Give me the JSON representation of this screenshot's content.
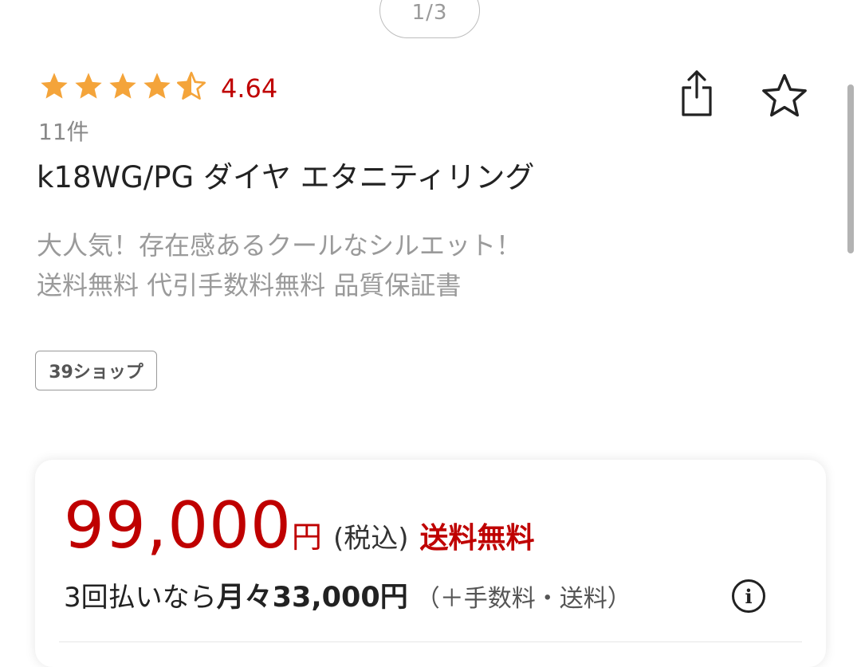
{
  "gallery": {
    "page_indicator": "1/3"
  },
  "rating": {
    "value": "4.64",
    "stars_filled": 4.5,
    "stars_total": 5,
    "review_count": "11件",
    "star_color": "#f4a43a",
    "value_color": "#bf0000"
  },
  "actions": {
    "share_icon": "share-icon",
    "favorite_icon": "star-outline-icon"
  },
  "product": {
    "title": "k18WG/PG ダイヤ エタニティリング",
    "catch_copy_line1": "大人気！存在感あるクールなシルエット！",
    "catch_copy_line2": "送料無料  代引手数料無料 品質保証書",
    "shop_tag": "39ショップ"
  },
  "price": {
    "amount": "99,000",
    "currency": "円",
    "tax_note": "(税込)",
    "shipping": "送料無料",
    "installment_prefix": "3回払いなら",
    "installment_monthly": "月々33,000円",
    "installment_note": "（＋手数料・送料）",
    "info_icon": "info-icon",
    "accent_color": "#bf0000"
  }
}
